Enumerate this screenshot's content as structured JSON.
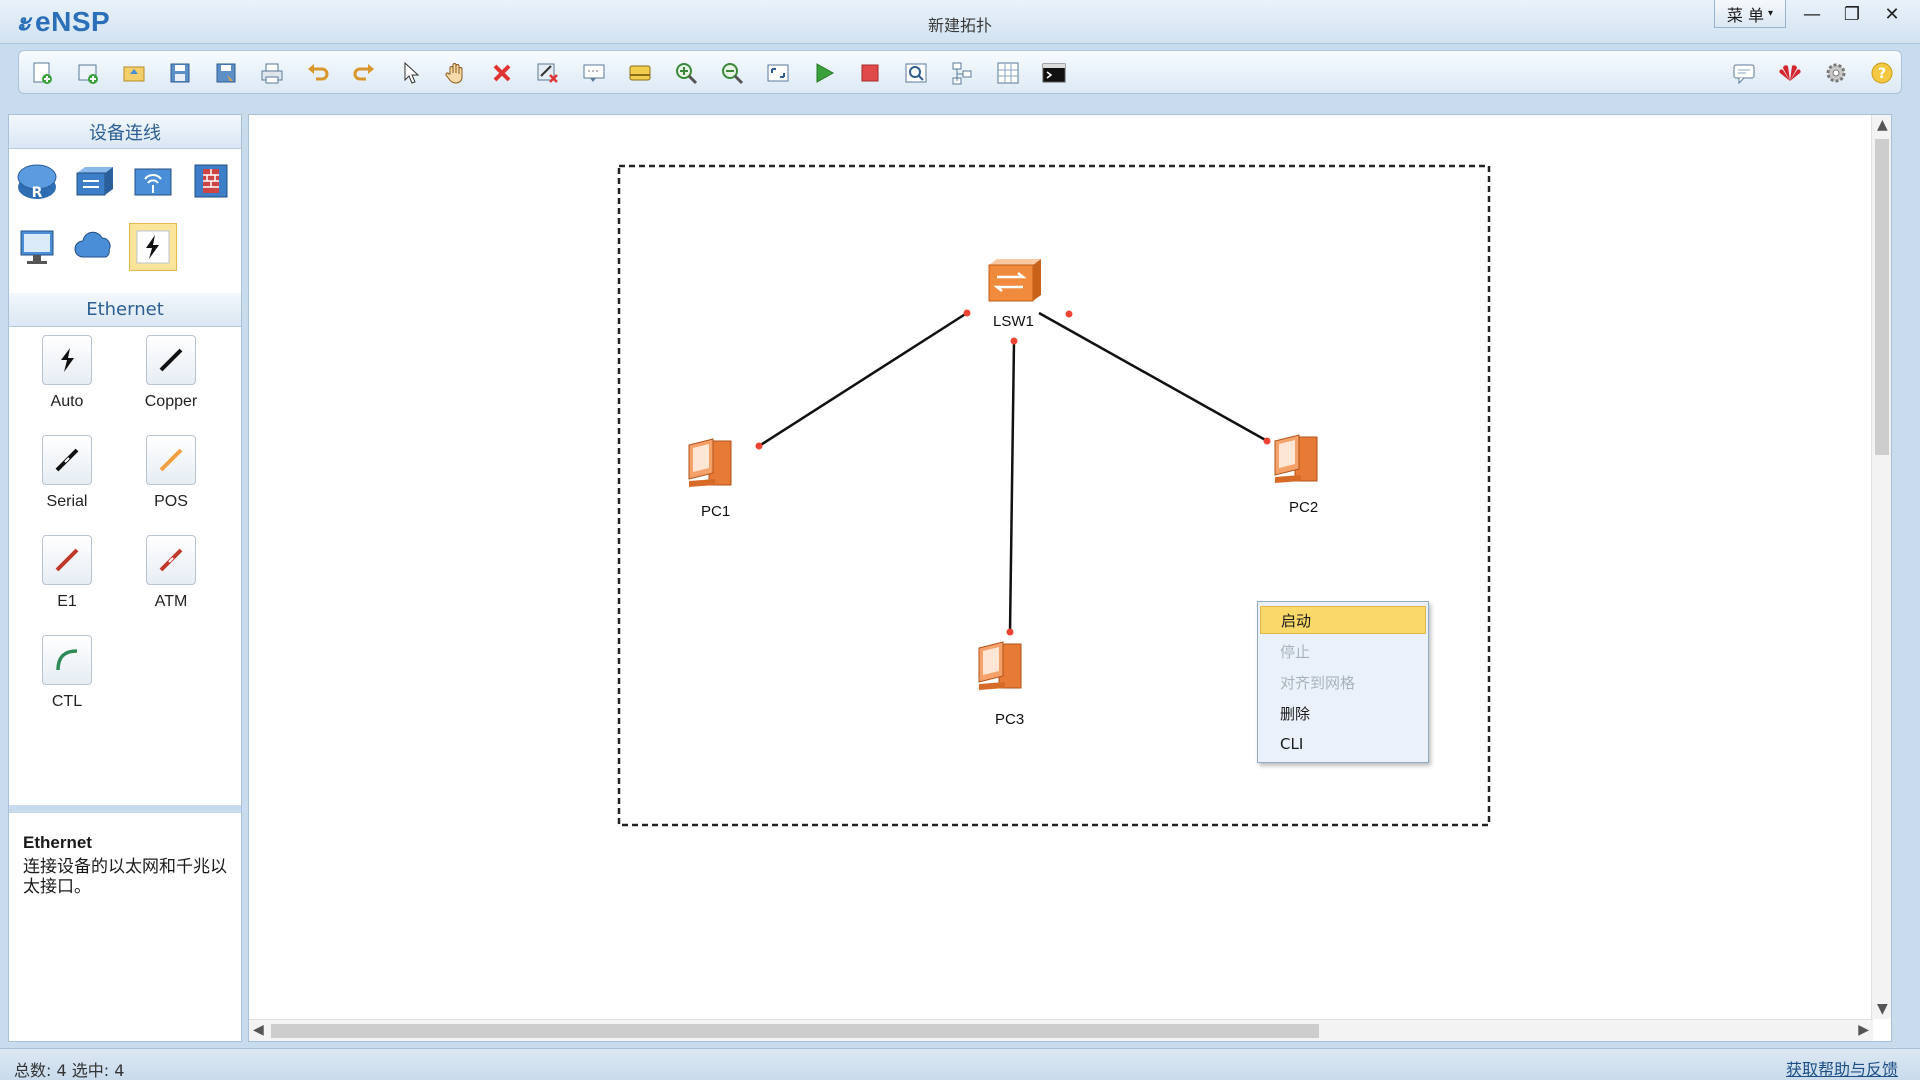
{
  "app": {
    "name": "eNSP",
    "window_title": "新建拓扑",
    "menu_label": "菜 单"
  },
  "toolbar": {
    "icons": [
      "new-topology-icon",
      "new-lab-icon",
      "open-icon",
      "save-icon",
      "save-as-icon",
      "print-icon",
      "undo-icon",
      "redo-icon",
      "select-pointer-icon",
      "pan-hand-icon",
      "delete-icon",
      "delete-all-links-icon",
      "add-text-icon",
      "palette-icon",
      "zoom-in-icon",
      "zoom-out-icon",
      "fit-icon",
      "start-device-icon",
      "stop-device-icon",
      "capture-icon",
      "topology-tree-icon",
      "grid-icon",
      "cli-window-icon"
    ],
    "right_icons": [
      "chat-icon",
      "huawei-logo-icon",
      "settings-icon",
      "help-icon"
    ]
  },
  "left_panel": {
    "device_header": "设备连线",
    "devices": [
      "router-icon",
      "switch-icon",
      "wireless-icon",
      "firewall-icon",
      "pc-terminal-icon",
      "cloud-icon",
      "connection-icon"
    ],
    "ethernet_header": "Ethernet",
    "cables": [
      {
        "label": "Auto",
        "color": "#222222"
      },
      {
        "label": "Copper",
        "color": "#111111"
      },
      {
        "label": "Serial",
        "color": "#111111"
      },
      {
        "label": "POS",
        "color": "#f0a040"
      },
      {
        "label": "E1",
        "color": "#c0392b"
      },
      {
        "label": "ATM",
        "color": "#c0392b"
      },
      {
        "label": "CTL",
        "color": "#2e8b57"
      }
    ],
    "description": {
      "title": "Ethernet",
      "text": "连接设备的以太网和千兆以太接口。"
    }
  },
  "topology": {
    "devices": [
      {
        "label": "LSW1"
      },
      {
        "label": "PC1"
      },
      {
        "label": "PC2"
      },
      {
        "label": "PC3"
      }
    ]
  },
  "context_menu": {
    "items": [
      {
        "label": "启动",
        "state": "highlighted"
      },
      {
        "label": "停止",
        "state": "disabled"
      },
      {
        "label": "对齐到网格",
        "state": "disabled"
      },
      {
        "label": "删除",
        "state": "enabled"
      },
      {
        "label": "CLI",
        "state": "enabled"
      }
    ]
  },
  "status": {
    "counts": "总数: 4 选中: 4",
    "feedback_link": "获取帮助与反馈"
  }
}
